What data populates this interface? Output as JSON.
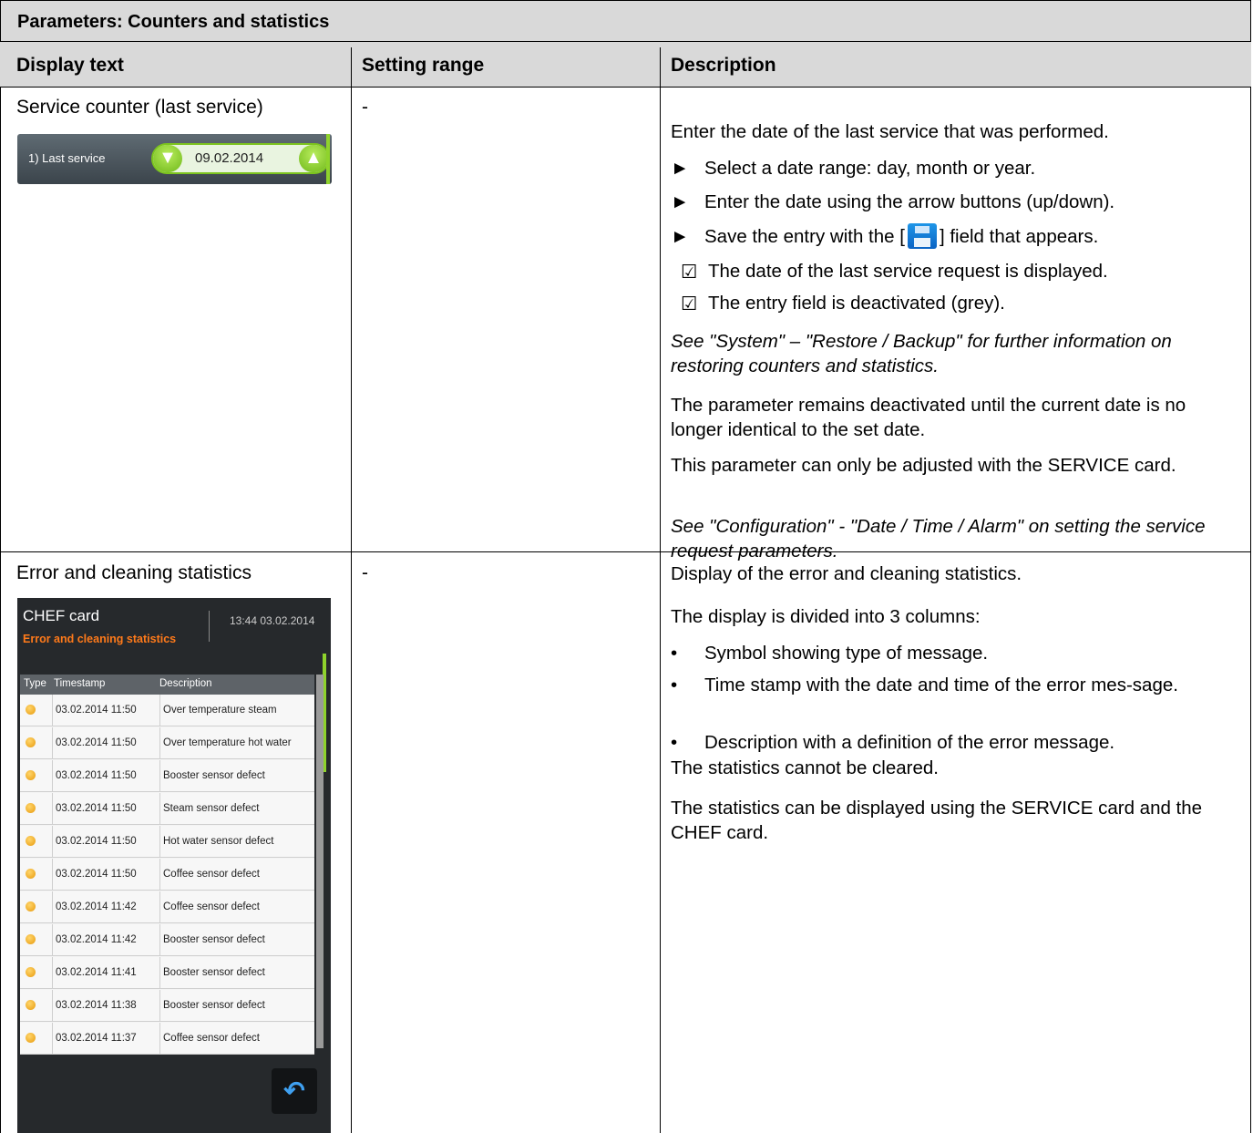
{
  "table_title": "Parameters: Counters and statistics",
  "headers": {
    "display_text": "Display text",
    "setting_range": "Setting range",
    "description": "Description"
  },
  "row1": {
    "display_text": "Service counter (last service)",
    "setting_range": "-",
    "widget": {
      "label": "1) Last service",
      "date": "09.02.2014",
      "down_icon": "chevron-down-icon",
      "up_icon": "chevron-up-icon"
    },
    "desc_intro": "Enter the date of the last service that was performed.",
    "steps": [
      "Select a date range: day, month or year.",
      "Enter the date using the arrow buttons (up/down).",
      "Save the entry with the [",
      "] field that appears."
    ],
    "results": [
      "The date of the last service request is displayed.",
      "The entry field is deactivated (grey)."
    ],
    "note_restore": "See \"System\" – \"Restore / Backup\" for further information on restoring counters and statistics.",
    "note_deactivated": "The parameter remains deactivated until the current date is no longer identical to the set date.",
    "note_service_card": "This parameter can only be adjusted with the SERVICE card.",
    "note_config": "See \"Configuration\" - \"Date / Time / Alarm\" on setting the service request parameters."
  },
  "row2": {
    "display_text": "Error and cleaning statistics",
    "setting_range": "-",
    "desc_intro": "Display of the error and cleaning statistics.",
    "desc_columns": "The display is divided into 3 columns:",
    "bullets": [
      "Symbol showing type of message.",
      "Time stamp with the date and time of the error mes-sage.",
      "Description with a definition of the error message."
    ],
    "note_cleared": "The statistics cannot be cleared.",
    "note_display": "The statistics can be displayed using the SERVICE card and the CHEF card.",
    "screen": {
      "title": "CHEF card",
      "subtitle": "Error and cleaning statistics",
      "time": "13:44  03.02.2014",
      "columns": [
        "Type",
        "Timestamp",
        "Description"
      ],
      "rows": [
        {
          "timestamp": "03.02.2014 11:50",
          "description": "Over temperature steam"
        },
        {
          "timestamp": "03.02.2014 11:50",
          "description": "Over temperature hot water"
        },
        {
          "timestamp": "03.02.2014 11:50",
          "description": "Booster sensor defect"
        },
        {
          "timestamp": "03.02.2014 11:50",
          "description": "Steam sensor defect"
        },
        {
          "timestamp": "03.02.2014 11:50",
          "description": "Hot water sensor defect"
        },
        {
          "timestamp": "03.02.2014 11:50",
          "description": "Coffee sensor defect"
        },
        {
          "timestamp": "03.02.2014 11:42",
          "description": "Coffee sensor defect"
        },
        {
          "timestamp": "03.02.2014 11:42",
          "description": "Booster sensor defect"
        },
        {
          "timestamp": "03.02.2014 11:41",
          "description": "Booster sensor defect"
        },
        {
          "timestamp": "03.02.2014 11:38",
          "description": "Booster sensor defect"
        },
        {
          "timestamp": "03.02.2014 11:37",
          "description": "Coffee sensor defect"
        }
      ],
      "status_icon": "warning-dot-icon",
      "back_icon": "back-arrow-icon",
      "accent_color": "#8fd32c",
      "subtitle_color": "#ff7a1a"
    }
  },
  "symbols": {
    "arrow": "►",
    "check": "☑",
    "bullet": "•",
    "save_icon": "save-floppy-icon"
  }
}
